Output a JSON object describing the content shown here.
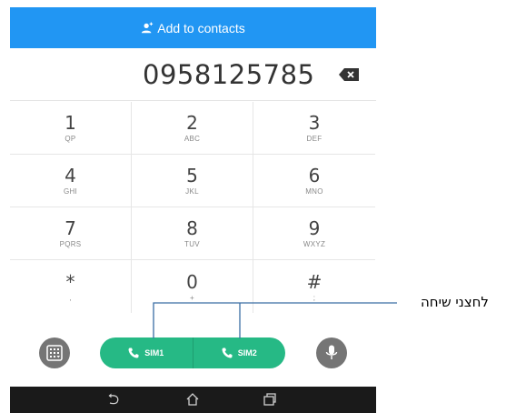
{
  "header": {
    "add_contacts_label": "Add to contacts"
  },
  "dialer": {
    "number": "0958125785"
  },
  "keypad": [
    {
      "digit": "1",
      "letters": "QP"
    },
    {
      "digit": "2",
      "letters": "ABC"
    },
    {
      "digit": "3",
      "letters": "DEF"
    },
    {
      "digit": "4",
      "letters": "GHI"
    },
    {
      "digit": "5",
      "letters": "JKL"
    },
    {
      "digit": "6",
      "letters": "MNO"
    },
    {
      "digit": "7",
      "letters": "PQRS"
    },
    {
      "digit": "8",
      "letters": "TUV"
    },
    {
      "digit": "9",
      "letters": "WXYZ"
    },
    {
      "digit": "*",
      "letters": ","
    },
    {
      "digit": "0",
      "letters": "+"
    },
    {
      "digit": "#",
      "letters": ";"
    }
  ],
  "actions": {
    "sim1_label": "SIM1",
    "sim2_label": "SIM2"
  },
  "annotation": {
    "text": "לחצני שיחה"
  },
  "colors": {
    "header": "#2196f3",
    "call": "#26b985",
    "nav": "#1a1a1a"
  }
}
